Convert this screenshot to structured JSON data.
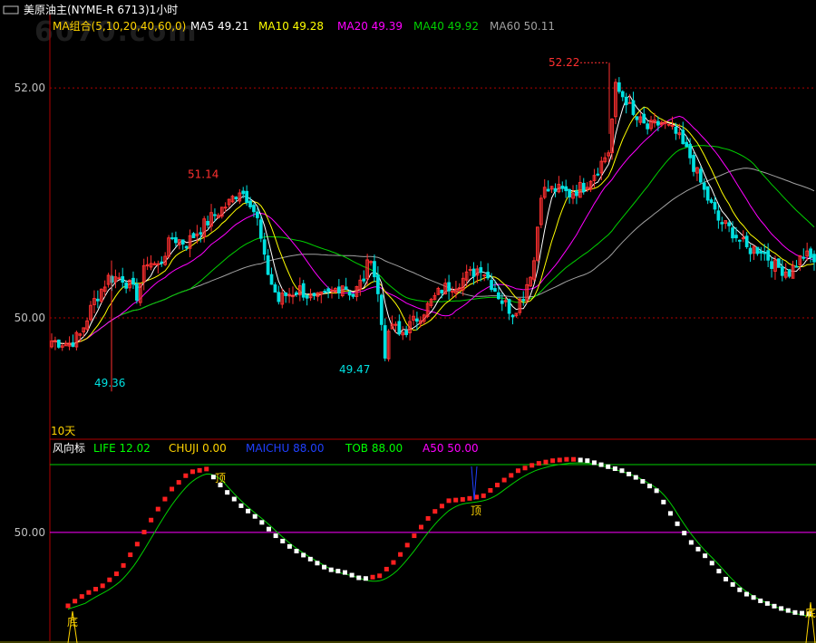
{
  "title_bar": {
    "icon": "window-restore-icon",
    "title": "美原油主(NYME-R 6713)1小时"
  },
  "watermark": "6070.com",
  "ma_legend": [
    {
      "label": "MA组合(5,10,20,40,60,0)",
      "color": "#ffd400"
    },
    {
      "label": "MA5 49.21",
      "color": "#ffffff"
    },
    {
      "label": "MA10 49.28",
      "color": "#ffff00"
    },
    {
      "label": "MA20 49.39",
      "color": "#ff00ff"
    },
    {
      "label": "MA40 49.92",
      "color": "#00d000"
    },
    {
      "label": "MA60 50.11",
      "color": "#a0a0a0"
    }
  ],
  "price_axis": {
    "labels": [
      "52.00",
      "50.00"
    ]
  },
  "annotations": {
    "high": "52.22",
    "peak1": "51.14",
    "low1": "49.36",
    "low2": "49.47",
    "period": "10天"
  },
  "indicator": {
    "title": "风向标",
    "items": [
      {
        "label": "LIFE",
        "value": "12.02",
        "color": "#00ff00"
      },
      {
        "label": "CHUJI",
        "value": "0.00",
        "color": "#ffd400"
      },
      {
        "label": "MAICHU",
        "value": "88.00",
        "color": "#2040ff"
      },
      {
        "label": "TOB",
        "value": "88.00",
        "color": "#00ff00"
      },
      {
        "label": "A50",
        "value": "50.00",
        "color": "#ff00ff"
      }
    ],
    "axis_label": "50.00",
    "signals": {
      "top": "顶",
      "bottom": "底"
    }
  },
  "chart_data": [
    {
      "type": "candlestick",
      "title": "美原油主(NYME-R 6713)1小时",
      "ylim": [
        49.0,
        52.45
      ],
      "gridlines": [
        52.0,
        50.0
      ],
      "annotated_high": 52.22,
      "annotated_low": 49.36,
      "series": [
        {
          "name": "MA5",
          "value": 49.21
        },
        {
          "name": "MA10",
          "value": 49.28
        },
        {
          "name": "MA20",
          "value": 49.39
        },
        {
          "name": "MA40",
          "value": 49.92
        },
        {
          "name": "MA60",
          "value": 50.11
        }
      ],
      "close_path": [
        [
          0,
          49.8
        ],
        [
          5,
          49.78
        ],
        [
          8,
          49.85
        ],
        [
          12,
          50.15
        ],
        [
          16,
          50.35
        ],
        [
          20,
          50.35
        ],
        [
          24,
          50.2
        ],
        [
          27,
          50.5
        ],
        [
          30,
          50.45
        ],
        [
          34,
          50.7
        ],
        [
          38,
          50.65
        ],
        [
          42,
          50.78
        ],
        [
          46,
          50.9
        ],
        [
          50,
          51.0
        ],
        [
          53,
          51.12
        ],
        [
          56,
          51.02
        ],
        [
          58,
          50.85
        ],
        [
          60,
          50.5
        ],
        [
          62,
          50.3
        ],
        [
          64,
          50.15
        ],
        [
          66,
          50.2
        ],
        [
          70,
          50.25
        ],
        [
          74,
          50.15
        ],
        [
          78,
          50.2
        ],
        [
          82,
          50.3
        ],
        [
          85,
          50.2
        ],
        [
          88,
          50.35
        ],
        [
          90,
          50.55
        ],
        [
          92,
          50.2
        ],
        [
          94,
          49.7
        ],
        [
          96,
          49.95
        ],
        [
          98,
          49.85
        ],
        [
          100,
          49.9
        ],
        [
          103,
          50.0
        ],
        [
          106,
          50.1
        ],
        [
          110,
          50.25
        ],
        [
          114,
          50.3
        ],
        [
          118,
          50.38
        ],
        [
          121,
          50.45
        ],
        [
          124,
          50.3
        ],
        [
          127,
          50.15
        ],
        [
          130,
          50.05
        ],
        [
          133,
          50.2
        ],
        [
          136,
          50.5
        ],
        [
          138,
          51.1
        ],
        [
          142,
          51.12
        ],
        [
          146,
          51.08
        ],
        [
          150,
          51.15
        ],
        [
          154,
          51.3
        ],
        [
          157,
          51.45
        ],
        [
          159,
          52.0
        ],
        [
          162,
          51.9
        ],
        [
          164,
          51.75
        ],
        [
          168,
          51.65
        ],
        [
          172,
          51.7
        ],
        [
          176,
          51.6
        ],
        [
          180,
          51.4
        ],
        [
          184,
          51.1
        ],
        [
          188,
          50.85
        ],
        [
          192,
          50.75
        ],
        [
          196,
          50.6
        ],
        [
          200,
          50.6
        ],
        [
          204,
          50.45
        ],
        [
          208,
          50.4
        ],
        [
          212,
          50.55
        ],
        [
          215,
          50.5
        ]
      ]
    },
    {
      "type": "line",
      "title": "风向标",
      "series": [
        {
          "name": "LIFE",
          "value": 12.02
        },
        {
          "name": "CHUJI",
          "value": 0.0
        },
        {
          "name": "MAICHU",
          "value": 88.0
        },
        {
          "name": "TOB",
          "value": 88.0
        },
        {
          "name": "A50",
          "value": 50.0
        }
      ],
      "ylim": [
        0,
        100
      ],
      "signals": [
        {
          "label": "顶",
          "index": 2
        },
        {
          "label": "顶",
          "index": 6
        },
        {
          "label": "底",
          "index": 0
        },
        {
          "label": "底",
          "index": 12
        }
      ],
      "path": [
        [
          0,
          6
        ],
        [
          5,
          13
        ],
        [
          10,
          18
        ],
        [
          15,
          27
        ],
        [
          20,
          43
        ],
        [
          25,
          61
        ],
        [
          30,
          76
        ],
        [
          35,
          86
        ],
        [
          40,
          88
        ],
        [
          45,
          76
        ],
        [
          50,
          66
        ],
        [
          55,
          58
        ],
        [
          60,
          48
        ],
        [
          65,
          40
        ],
        [
          70,
          34
        ],
        [
          75,
          28
        ],
        [
          80,
          26
        ],
        [
          85,
          22
        ],
        [
          90,
          24
        ],
        [
          95,
          34
        ],
        [
          100,
          48
        ],
        [
          105,
          61
        ],
        [
          110,
          69
        ],
        [
          115,
          70
        ],
        [
          120,
          72
        ],
        [
          125,
          80
        ],
        [
          130,
          87
        ],
        [
          135,
          91
        ],
        [
          140,
          93
        ],
        [
          145,
          94
        ],
        [
          150,
          93
        ],
        [
          155,
          90
        ],
        [
          160,
          87
        ],
        [
          165,
          82
        ],
        [
          170,
          75
        ],
        [
          175,
          58
        ],
        [
          180,
          44
        ],
        [
          185,
          34
        ],
        [
          190,
          22
        ],
        [
          195,
          14
        ],
        [
          200,
          9
        ],
        [
          205,
          5
        ],
        [
          210,
          2
        ],
        [
          215,
          1
        ]
      ]
    }
  ]
}
